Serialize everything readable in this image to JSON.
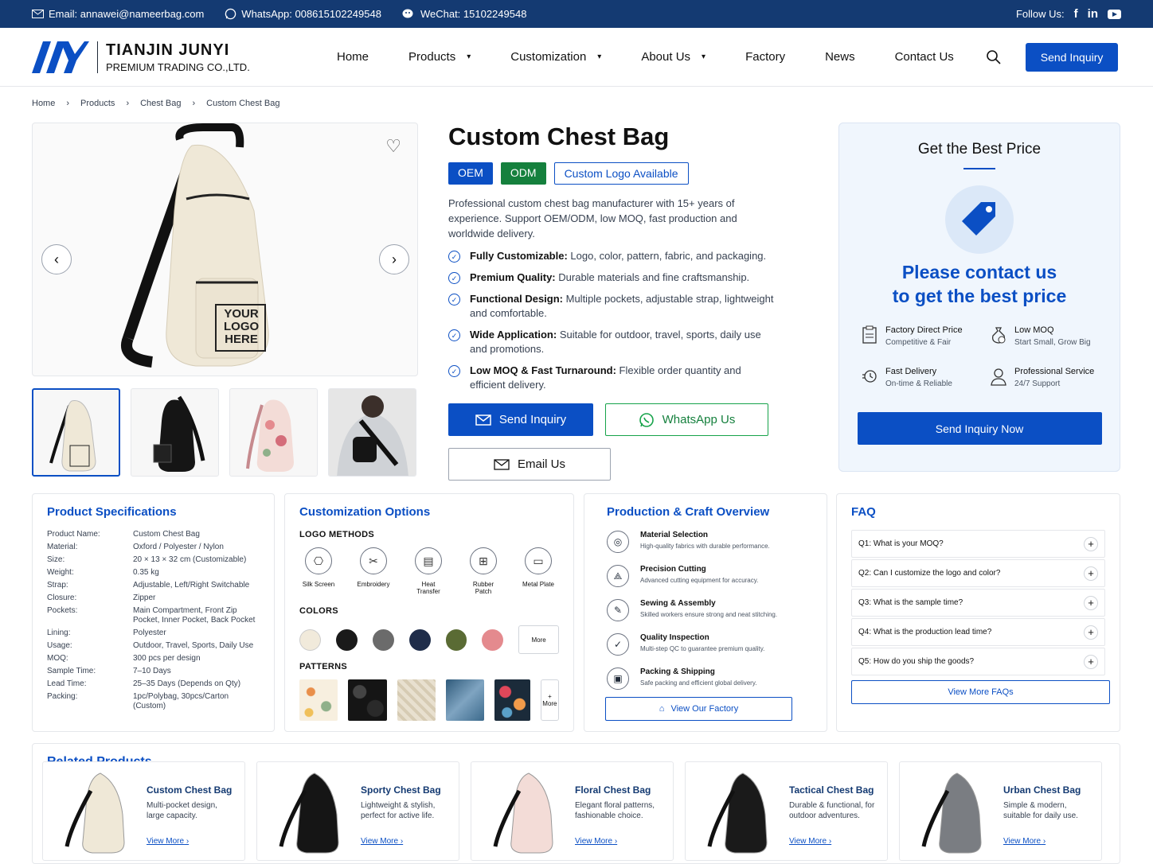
{
  "topbar": {
    "email": "Email: annawei@nameerbag.com",
    "whatsapp": "WhatsApp: 008615102249548",
    "wechat": "WeChat: 15102249548",
    "follow": "Follow Us:",
    "social_icons": [
      "facebook-icon",
      "linkedin-icon",
      "youtube-icon"
    ]
  },
  "brand": {
    "name": "TIANJIN JUNYI",
    "subtitle": "PREMIUM TRADING CO.,LTD.",
    "accent": "#0b4fc4",
    "dark": "#143a72"
  },
  "nav": {
    "items": [
      "Home",
      "Products",
      "Customization",
      "About Us",
      "Factory",
      "News",
      "Contact Us"
    ],
    "dropdowns": [
      false,
      true,
      true,
      true,
      false,
      false,
      false
    ],
    "cta": "Send Inquiry"
  },
  "breadcrumb": [
    "Home",
    "Products",
    "Chest Bag",
    "Custom Chest Bag"
  ],
  "product": {
    "title": "Custom Chest Bag",
    "badges": [
      "OEM",
      "ODM",
      "Custom Logo Available"
    ],
    "logo_text": [
      "YOUR",
      "LOGO",
      "HERE"
    ],
    "description": "Professional custom chest bag manufacturer with 15+ years of experience. Support OEM/ODM, low MOQ, fast production and worldwide delivery.",
    "features": [
      {
        "title": "Fully Customizable:",
        "text": "Logo, color, pattern, fabric, and packaging."
      },
      {
        "title": "Premium Quality:",
        "text": "Durable materials and fine craftsmanship."
      },
      {
        "title": "Functional Design:",
        "text": "Multiple pockets, adjustable strap, lightweight and comfortable."
      },
      {
        "title": "Wide Application:",
        "text": "Suitable for outdoor, travel, sports, daily use and promotions."
      },
      {
        "title": "Low MOQ & Fast Turnaround:",
        "text": "Flexible order quantity and efficient delivery."
      }
    ],
    "buttons": {
      "inquiry": "Send Inquiry",
      "whatsapp": "WhatsApp Us",
      "email": "Email Us"
    }
  },
  "best_price": {
    "title": "Get the Best Price",
    "headline_1": "Please contact us",
    "headline_2": "to get the best price",
    "benefits": [
      {
        "title": "Factory Direct Price",
        "sub": "Competitive & Fair"
      },
      {
        "title": "Low MOQ",
        "sub": "Start Small, Grow Big"
      },
      {
        "title": "Fast Delivery",
        "sub": "On-time & Reliable"
      },
      {
        "title": "Professional Service",
        "sub": "24/7 Support"
      }
    ],
    "button": "Send Inquiry Now"
  },
  "specs": {
    "title": "Product Specifications",
    "rows": [
      [
        "Product Name:",
        "Custom Chest Bag"
      ],
      [
        "Material:",
        "Oxford / Polyester / Nylon"
      ],
      [
        "Size:",
        "20 × 13 × 32 cm (Customizable)"
      ],
      [
        "Weight:",
        "0.35 kg"
      ],
      [
        "Strap:",
        "Adjustable, Left/Right Switchable"
      ],
      [
        "Closure:",
        "Zipper"
      ],
      [
        "Pockets:",
        "Main Compartment, Front Zip Pocket, Inner Pocket, Back Pocket"
      ],
      [
        "Lining:",
        "Polyester"
      ],
      [
        "Usage:",
        "Outdoor, Travel, Sports, Daily Use"
      ],
      [
        "MOQ:",
        "300 pcs per design"
      ],
      [
        "Sample Time:",
        "7–10 Days"
      ],
      [
        "Lead Time:",
        "25–35 Days (Depends on Qty)"
      ],
      [
        "Packing:",
        "1pc/Polybag, 30pcs/Carton (Custom)"
      ]
    ]
  },
  "custom": {
    "title": "Customization Options",
    "logo_label": "LOGO METHODS",
    "logo_methods": [
      "Silk Screen",
      "Embroidery",
      "Heat Transfer",
      "Rubber Patch",
      "Metal Plate"
    ],
    "colors_label": "COLORS",
    "colors": [
      "#f1eadb",
      "#1a1a1a",
      "#6b6b6b",
      "#1f2d4a",
      "#5a6b34",
      "#e48a8e"
    ],
    "more": "More",
    "patterns_label": "PATTERNS",
    "patterns_more": "More"
  },
  "production": {
    "title": "Production & Craft Overview",
    "steps": [
      {
        "title": "Material Selection",
        "sub": "High-quality fabrics with durable performance."
      },
      {
        "title": "Precision Cutting",
        "sub": "Advanced cutting equipment for accuracy."
      },
      {
        "title": "Sewing & Assembly",
        "sub": "Skilled workers ensure strong and neat stitching."
      },
      {
        "title": "Quality Inspection",
        "sub": "Multi-step QC to guarantee premium quality."
      },
      {
        "title": "Packing & Shipping",
        "sub": "Safe packing and efficient global delivery."
      }
    ],
    "button": "View Our Factory"
  },
  "faq": {
    "title": "FAQ",
    "items": [
      "Q1: What is your MOQ?",
      "Q2: Can I customize the logo and color?",
      "Q3: What is the sample time?",
      "Q4: What is the production lead time?",
      "Q5: How do you ship the goods?"
    ],
    "button": "View More FAQs"
  },
  "related": {
    "title": "Related Products",
    "items": [
      {
        "name": "Custom Chest Bag",
        "desc": "Multi-pocket design, large capacity.",
        "link": "View More"
      },
      {
        "name": "Sporty Chest Bag",
        "desc": "Lightweight & stylish, perfect for active life.",
        "link": "View More"
      },
      {
        "name": "Floral Chest Bag",
        "desc": "Elegant floral patterns, fashionable choice.",
        "link": "View More"
      },
      {
        "name": "Tactical Chest Bag",
        "desc": "Durable & functional, for outdoor adventures.",
        "link": "View More"
      },
      {
        "name": "Urban Chest Bag",
        "desc": "Simple & modern, suitable for daily use.",
        "link": "View More"
      }
    ]
  }
}
